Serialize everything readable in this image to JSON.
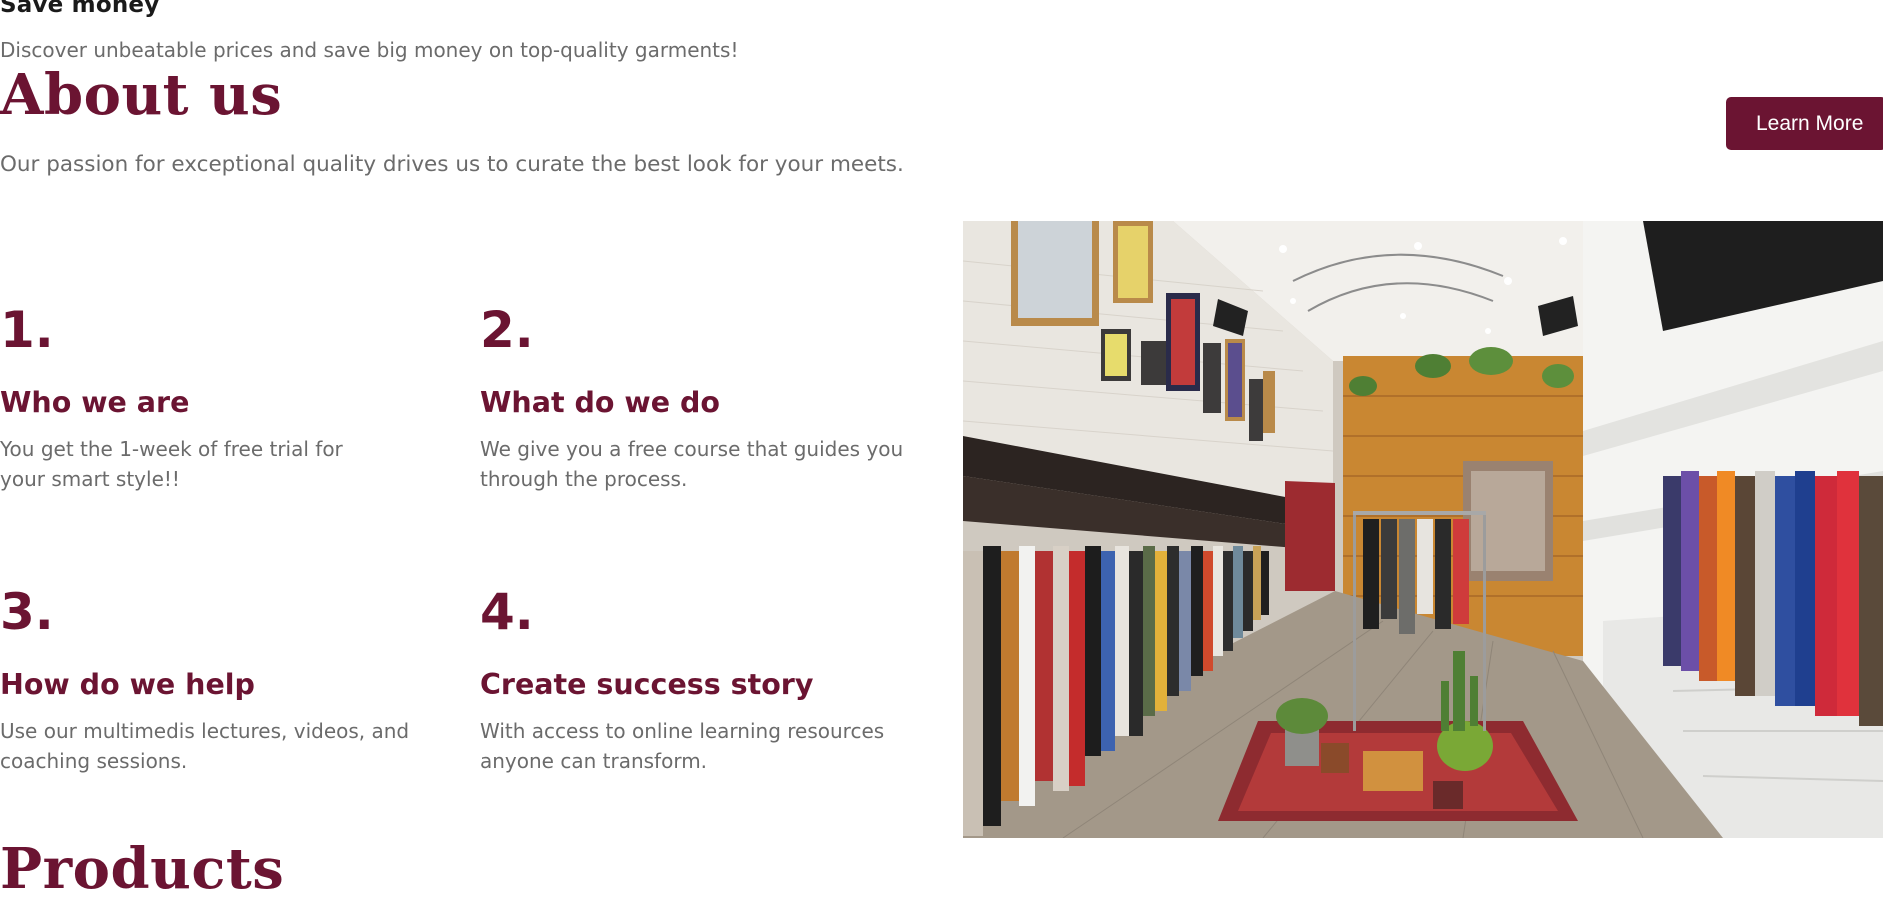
{
  "save": {
    "title": "Save money",
    "description": "Discover unbeatable prices and save big money on top-quality garments!"
  },
  "about": {
    "title": "About us",
    "description": "Our passion for exceptional quality drives us to curate the best look for your meets.",
    "learn_more_label": "Learn More"
  },
  "steps": [
    {
      "number": "1.",
      "title": "Who we are",
      "description": "You get the 1-week of free trial for your smart style!!"
    },
    {
      "number": "2.",
      "title": "What do we do",
      "description": "We give you a free course that guides you through the process."
    },
    {
      "number": "3.",
      "title": "How do we help",
      "description": "Use our multimedis lectures, videos, and coaching sessions."
    },
    {
      "number": "4.",
      "title": "Create success story",
      "description": "With access to online learning resources anyone can transform."
    }
  ],
  "products": {
    "title": "Products"
  },
  "colors": {
    "accent": "#6b1432",
    "text_muted": "#6b6b6b",
    "heading_dark": "#1a1a1a"
  }
}
